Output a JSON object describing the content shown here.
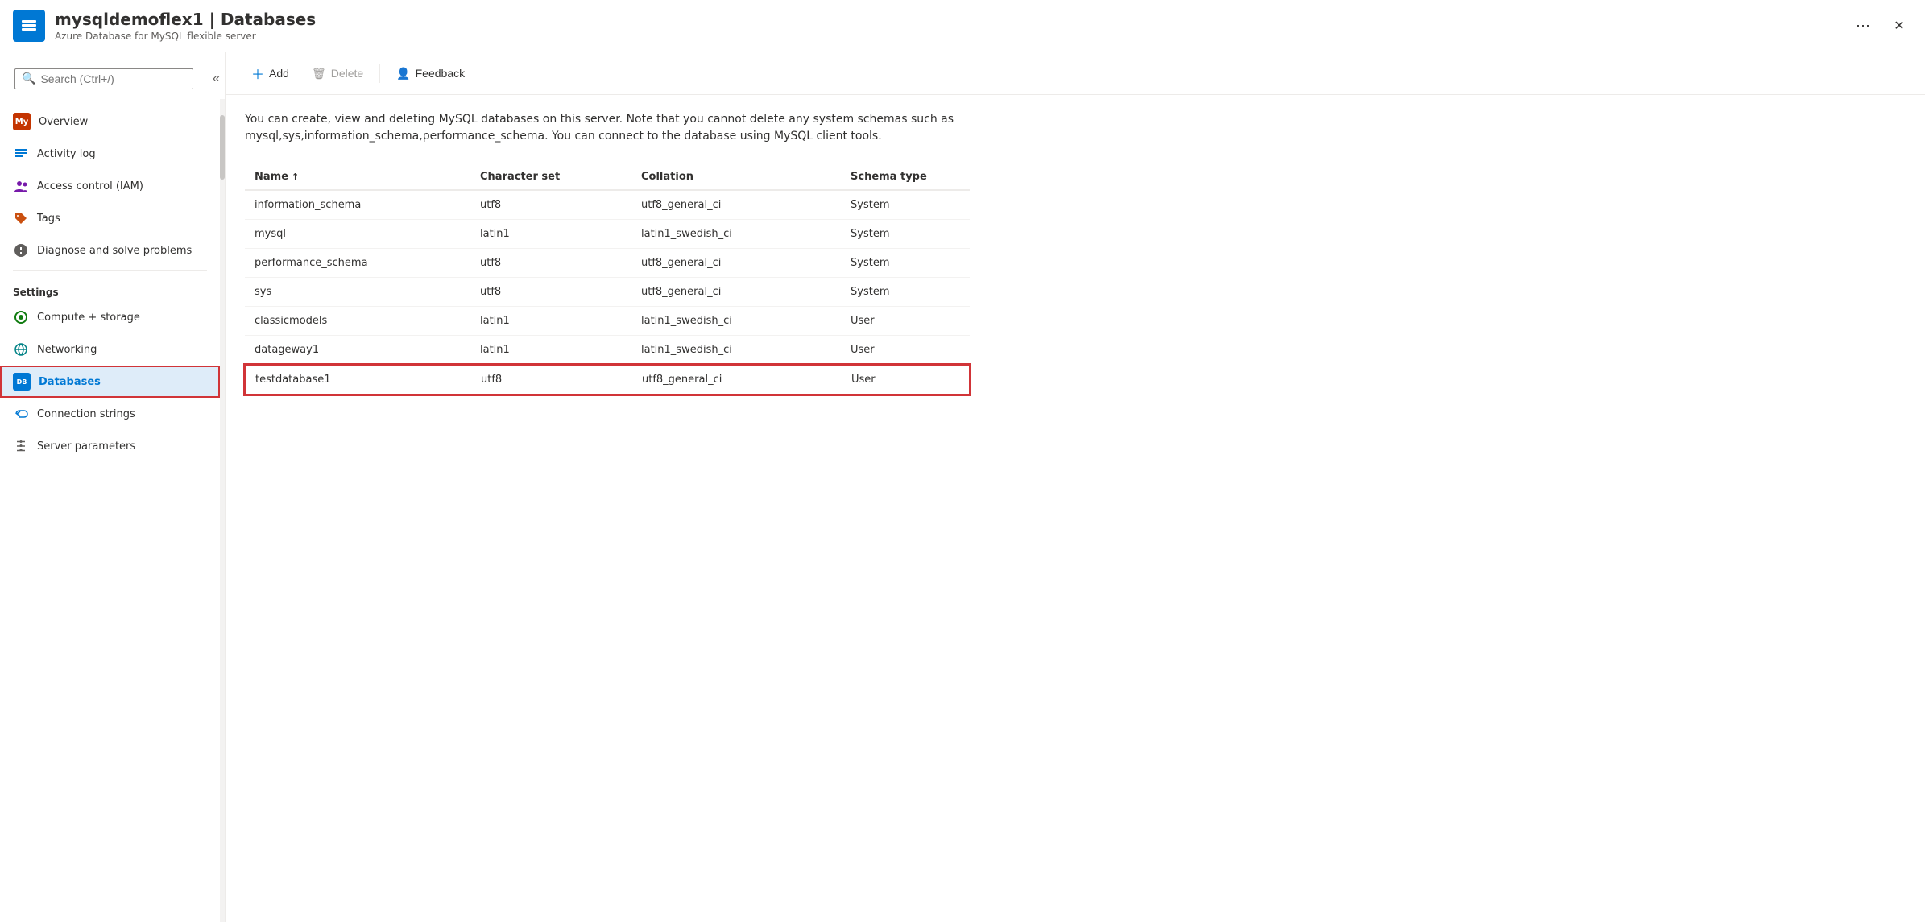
{
  "header": {
    "resource_name": "mysqldemoflex1",
    "page_title": "Databases",
    "subtitle": "Azure Database for MySQL flexible server",
    "more_icon": "⋯",
    "close_icon": "✕"
  },
  "sidebar": {
    "search_placeholder": "Search (Ctrl+/)",
    "collapse_icon": "«",
    "nav_items": [
      {
        "id": "overview",
        "label": "Overview",
        "icon": "my",
        "icon_type": "my"
      },
      {
        "id": "activity-log",
        "label": "Activity log",
        "icon": "≡",
        "icon_type": "list"
      },
      {
        "id": "access-control",
        "label": "Access control (IAM)",
        "icon": "👥",
        "icon_type": "people"
      },
      {
        "id": "tags",
        "label": "Tags",
        "icon": "🏷",
        "icon_type": "tag"
      },
      {
        "id": "diagnose",
        "label": "Diagnose and solve problems",
        "icon": "🔧",
        "icon_type": "wrench"
      }
    ],
    "settings_label": "Settings",
    "settings_items": [
      {
        "id": "compute-storage",
        "label": "Compute + storage",
        "icon": "⚙",
        "icon_type": "compute"
      },
      {
        "id": "networking",
        "label": "Networking",
        "icon": "🌐",
        "icon_type": "network"
      },
      {
        "id": "databases",
        "label": "Databases",
        "icon": "DB",
        "icon_type": "db",
        "active": true
      },
      {
        "id": "connection-strings",
        "label": "Connection strings",
        "icon": "🔗",
        "icon_type": "connection"
      },
      {
        "id": "server-parameters",
        "label": "Server parameters",
        "icon": "⚙",
        "icon_type": "gear"
      }
    ]
  },
  "toolbar": {
    "add_label": "Add",
    "delete_label": "Delete",
    "feedback_label": "Feedback"
  },
  "content": {
    "description": "You can create, view and deleting MySQL databases on this server. Note that you cannot delete any system schemas such as mysql,sys,information_schema,performance_schema. You can connect to the database using MySQL client tools.",
    "table": {
      "columns": [
        {
          "label": "Name",
          "sort": "↑"
        },
        {
          "label": "Character set",
          "sort": ""
        },
        {
          "label": "Collation",
          "sort": ""
        },
        {
          "label": "Schema type",
          "sort": ""
        }
      ],
      "rows": [
        {
          "name": "information_schema",
          "charset": "utf8",
          "collation": "utf8_general_ci",
          "schema_type": "System",
          "highlighted": false
        },
        {
          "name": "mysql",
          "charset": "latin1",
          "collation": "latin1_swedish_ci",
          "schema_type": "System",
          "highlighted": false
        },
        {
          "name": "performance_schema",
          "charset": "utf8",
          "collation": "utf8_general_ci",
          "schema_type": "System",
          "highlighted": false
        },
        {
          "name": "sys",
          "charset": "utf8",
          "collation": "utf8_general_ci",
          "schema_type": "System",
          "highlighted": false
        },
        {
          "name": "classicmodels",
          "charset": "latin1",
          "collation": "latin1_swedish_ci",
          "schema_type": "User",
          "highlighted": false
        },
        {
          "name": "datageway1",
          "charset": "latin1",
          "collation": "latin1_swedish_ci",
          "schema_type": "User",
          "highlighted": false
        },
        {
          "name": "testdatabase1",
          "charset": "utf8",
          "collation": "utf8_general_ci",
          "schema_type": "User",
          "highlighted": true
        }
      ]
    }
  }
}
